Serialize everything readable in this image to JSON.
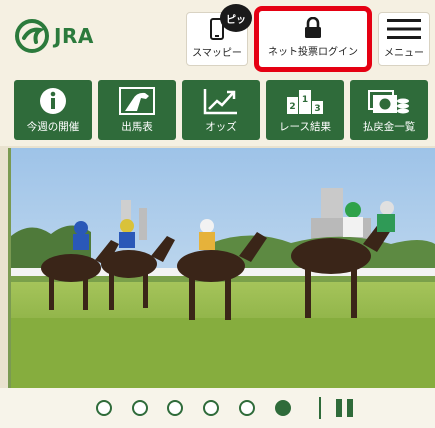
{
  "header": {
    "logo_text": "JRA",
    "smp_badge": "ピッ",
    "smp_label": "スマッピー",
    "login_label": "ネット投票ログイン",
    "menu_label": "メニュー"
  },
  "nav": {
    "items": [
      {
        "label": "今週の開催",
        "icon": "info-icon"
      },
      {
        "label": "出馬表",
        "icon": "horse-head-icon"
      },
      {
        "label": "オッズ",
        "icon": "trend-chart-icon"
      },
      {
        "label": "レース結果",
        "icon": "podium-icon"
      },
      {
        "label": "払戻金一覧",
        "icon": "yen-coins-icon"
      }
    ]
  },
  "carousel": {
    "slide_count": 6,
    "active_index": 5
  },
  "colors": {
    "brand_green": "#2f6b3a",
    "login_highlight": "#e50012",
    "header_bg": "#f5f0e2"
  }
}
